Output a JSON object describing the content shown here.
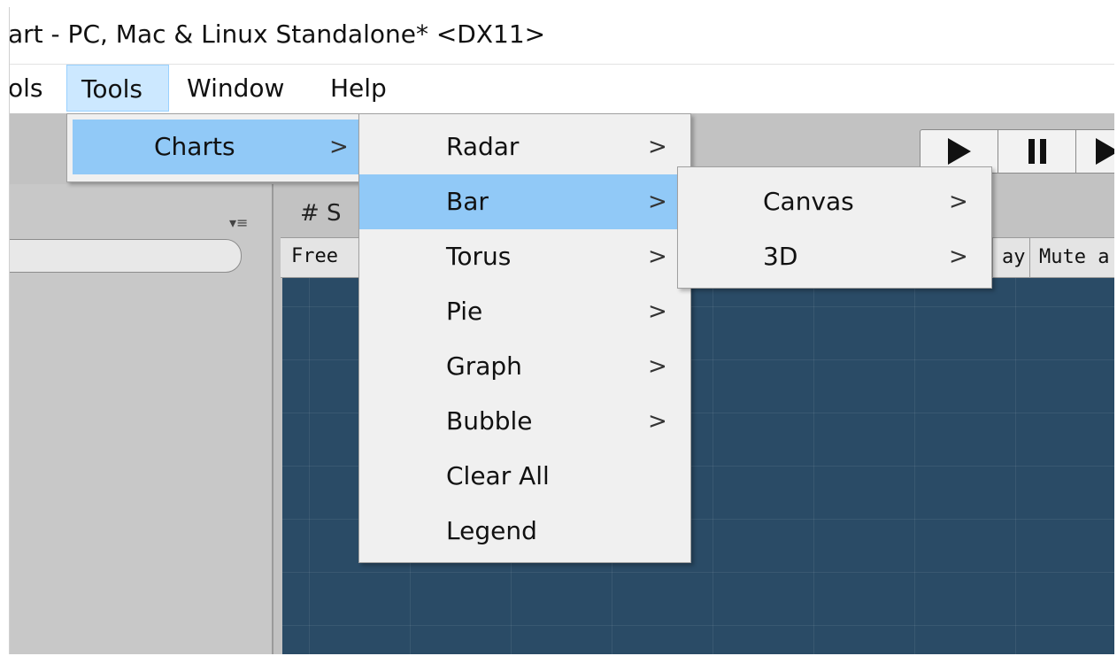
{
  "window": {
    "title": "art - PC, Mac & Linux Standalone* <DX11>"
  },
  "menubar": {
    "items": [
      {
        "label": "ols"
      },
      {
        "label": "Tools"
      },
      {
        "label": "Window"
      },
      {
        "label": "Help"
      }
    ]
  },
  "tools_menu": {
    "items": [
      {
        "label": "Charts",
        "arrow": ">"
      }
    ]
  },
  "charts_menu": {
    "items": [
      {
        "label": "Radar",
        "arrow": ">"
      },
      {
        "label": "Bar",
        "arrow": ">"
      },
      {
        "label": "Torus",
        "arrow": ">"
      },
      {
        "label": "Pie",
        "arrow": ">"
      },
      {
        "label": "Graph",
        "arrow": ">"
      },
      {
        "label": "Bubble",
        "arrow": ">"
      },
      {
        "label": "Clear All",
        "arrow": ""
      },
      {
        "label": "Legend",
        "arrow": ""
      }
    ]
  },
  "bar_menu": {
    "items": [
      {
        "label": "Canvas",
        "arrow": ">"
      },
      {
        "label": "3D",
        "arrow": ">"
      }
    ]
  },
  "scene": {
    "tab_label": "# S",
    "free_label": "Free",
    "gizmo_partial": "ay",
    "mute_label": "Mute a"
  },
  "panel": {
    "menu_glyph": "▾≡"
  },
  "colors": {
    "menu_highlight": "#91c9f7",
    "menubar_active": "#cce8ff",
    "scene_background": "#2a4b66"
  }
}
